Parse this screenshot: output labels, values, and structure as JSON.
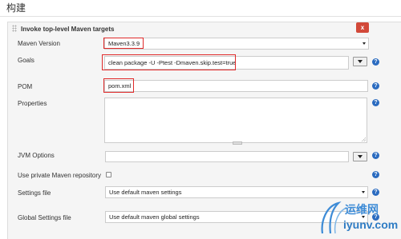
{
  "section": {
    "title": "构建"
  },
  "step": {
    "title": "Invoke top-level Maven targets",
    "close_label": "x"
  },
  "fields": {
    "maven_version": {
      "label": "Maven Version",
      "value": "Maven3.3.9"
    },
    "goals": {
      "label": "Goals",
      "value": "clean package -U -Ptest -Dmaven.skip.test=true"
    },
    "pom": {
      "label": "POM",
      "value": "pom.xml"
    },
    "properties": {
      "label": "Properties",
      "value": ""
    },
    "jvm_options": {
      "label": "JVM Options",
      "value": ""
    },
    "private_repo": {
      "label": "Use private Maven repository",
      "checked": false
    },
    "settings_file": {
      "label": "Settings file",
      "value": "Use default maven settings"
    },
    "global_settings_file": {
      "label": "Global Settings file",
      "value": "Use default maven global settings"
    }
  },
  "help_icon": "?",
  "watermark": {
    "cn": "运维网",
    "url": "iyunv.com"
  },
  "colors": {
    "highlight": "#e02a2a",
    "close": "#d24939",
    "help": "#2a6bc0",
    "watermark": "#3d8bd6"
  }
}
